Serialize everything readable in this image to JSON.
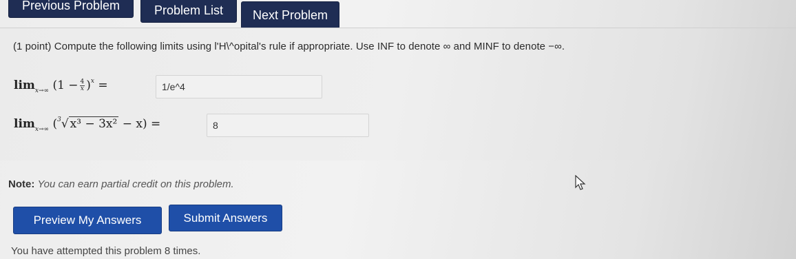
{
  "nav": {
    "previous": "Previous Problem",
    "list": "Problem List",
    "next": "Next Problem"
  },
  "problem": {
    "points": "(1 point)",
    "statement": "Compute the following limits using l'H\\^opital's rule if appropriate. Use INF to denote ∞ and MINF to denote −∞.",
    "limit1": {
      "lim": "lim",
      "sub": "x→∞",
      "open": "(1 −",
      "frac_num": "4",
      "frac_den": "x",
      "close": ")",
      "exp": "x",
      "eq": "=",
      "answer": "1/e^4"
    },
    "limit2": {
      "lim": "lim",
      "sub": "x→∞",
      "open": "(",
      "root_index": "3",
      "radicand": "x³ − 3x²",
      "rest": "− x)",
      "eq": "=",
      "answer": "8"
    }
  },
  "note": {
    "label": "Note:",
    "text": "You can earn partial credit on this problem."
  },
  "buttons": {
    "preview": "Preview My Answers",
    "submit": "Submit Answers"
  },
  "attempts": "You have attempted this problem 8 times.",
  "colors": {
    "nav_bg": "#1f2d54",
    "action_bg": "#1f4fa8"
  }
}
